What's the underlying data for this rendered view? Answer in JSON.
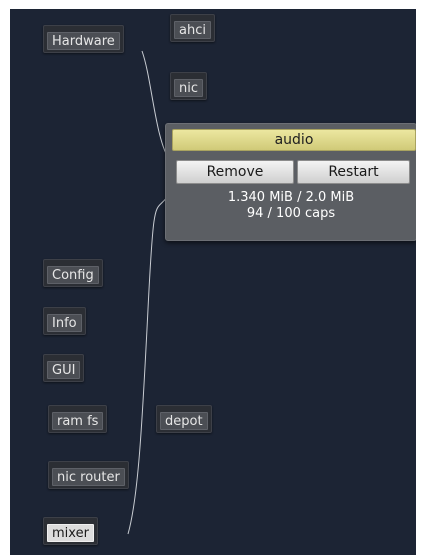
{
  "nodes": {
    "hardware": "Hardware",
    "ahci": "ahci",
    "nic": "nic",
    "config": "Config",
    "info": "Info",
    "gui": "GUI",
    "ram_fs": "ram fs",
    "depot": "depot",
    "nic_router": "nic router",
    "mixer": "mixer"
  },
  "popup": {
    "title": "audio",
    "remove_label": "Remove",
    "restart_label": "Restart",
    "memory": "1.340 MiB / 2.0 MiB",
    "caps": "94 / 100 caps"
  },
  "colors": {
    "background": "#1c2434",
    "node": "#4b4e54",
    "popup": "#5b5e63",
    "title_bar": "#e2dc8c",
    "wire": "#c8ccd2"
  }
}
